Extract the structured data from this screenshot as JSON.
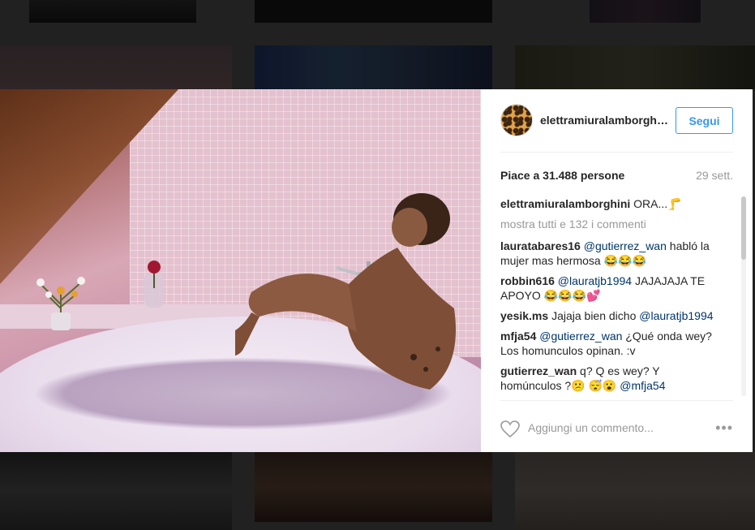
{
  "post": {
    "username": "elettramiuralamborghini",
    "follow_label": "Segui",
    "likes_text": "Piace a 31.488 persone",
    "date": "29 sett.",
    "show_all_comments": "mostra tutti e 132 i commenti",
    "add_comment_placeholder": "Aggiungi un commento...",
    "more_icon": "•••"
  },
  "comments": [
    {
      "user": "elettramiuralamborghini",
      "parts": [
        "ORA...🦵"
      ]
    },
    {
      "user": "lauratabares16",
      "mention": "@gutierrez_wan",
      "text": "habló la mujer mas hermosa 😂😂😂"
    },
    {
      "user": "robbin616",
      "mention": "@lauratjb1994",
      "text": "JAJAJAJA TE APOYO 😂😂😂💕"
    },
    {
      "user": "yesik.ms",
      "text": "Jajaja bien dicho",
      "mention_after": "@lauratjb1994"
    },
    {
      "user": "mfja54",
      "mention": "@gutierrez_wan",
      "text": "¿Qué onda wey? Los homunculos opinan. :v"
    },
    {
      "user": "gutierrez_wan",
      "text": "q? Q es wey? Y homúnculos ?😕 😴😮",
      "mention_after": "@mfja54"
    }
  ],
  "colors": {
    "accent": "#3897f0",
    "mention": "#003569",
    "muted": "#999999"
  }
}
